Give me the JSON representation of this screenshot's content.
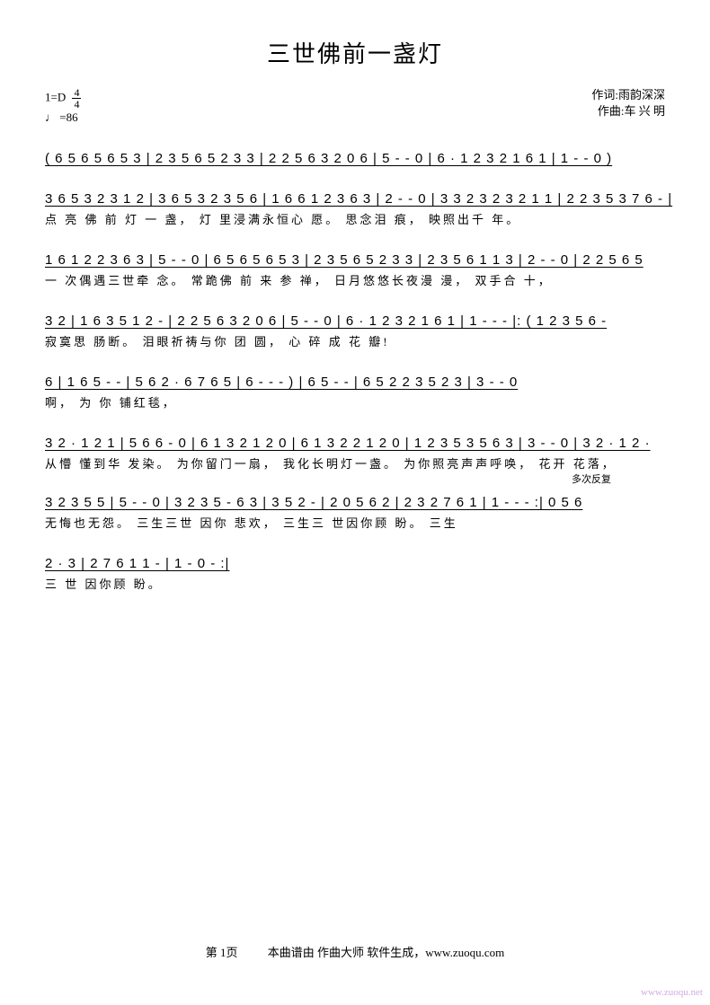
{
  "title": "三世佛前一盏灯",
  "key_sig": "1=D",
  "time_sig_top": "4",
  "time_sig_bot": "4",
  "tempo_mark": "♩ =86",
  "credits": {
    "lyricist_label": "作词:雨韵深深",
    "composer_label": "作曲:车 兴 明"
  },
  "intro_notation": "( 6 5 6 5 6 5 3 | 2 3 5 6 5 2 3 3 | 2 2 5 6 3 2 0 6 | 5  -  -  0 | 6 · 1 2 3 2 1 6 1 | 1  -  -  0  )",
  "lines": [
    {
      "notation": "3 6 5 3 2 3 1 2 | 3 6 5 3 2 3 5 6 | 1 6 6 1 2 3 6 3 | 2  -  -  0 | 3 3 2 3 2 3 2 1 1 | 2 2 3 5 3 7 6  - |",
      "lyrics": "点 亮 佛    前 灯 一   盏，    灯  里浸满永恒心  愿。            思念泪  痕，      映照出千    年。"
    },
    {
      "notation": "1 6 1 2 2 3 6 3 | 5  -  -  0 | 6 5 6 5 6 5 3 | 2 3 5 6 5 2 3 3 | 2 3 5 6 1 1 3 | 2  -  -  0 | 2 2 5 6 5",
      "lyrics": "一  次偶遇三世牵  念。             常跪佛      前 来  参  禅，    日月悠悠长夜漫  漫，            双手合  十，"
    },
    {
      "notation": "3 2 | 1 6 3 5 1 2  - | 2 2 5 6 3 2 0 6 | 5  -  -  0 | 6 · 1 2 3 2 1 6 1 | 1  -  -  - |: ( 1 2 3 5 6  -",
      "lyrics": "       寂寞思   肠断。    泪眼祈祷与你  团  圆，            心   碎 成  花      瓣!"
    },
    {
      "notation": "6 | 1 6 5  -  - | 5 6 2 · 6 7 6 5 | 6  -  -  - ) | 6  5  -  - | 6 5 2 2 3 5 2 3 | 3  -  -  0",
      "lyrics": "                                                                啊，              为  你    铺红毯，"
    },
    {
      "notation": "3 2 · 1 2 1 | 5 6 6  -  0 | 6 1 3 2 1 2 0 | 6 1 3 2 2 1 2 0 | 1 2 3 5 3 5 6 3 | 3  -  -  0 | 3 2 · 1 2 ·",
      "lyrics": "从懵  懂到华  发染。           为你留门一扇，   我化长明灯一盏。    为你照亮声声呼唤，               花开  花落，"
    },
    {
      "notation": "3 2 3 5 5 | 5  -  -  0 | 3 2 3 5  - 6 3 | 3 5 2  - | 2 0 5 6 2 | 2 3 2 7 6 1 | 1  -  -  - :| 0 5 6",
      "lyrics": "无悔也无怨。                  三生三世   因你    悲欢，     三生三    世因你顾   盼。                 三生",
      "anno": "多次反复"
    },
    {
      "notation": "2 · 3 | 2 7 6 1 1  - | 1  - 0  - :|",
      "lyrics": "三  世   因你顾   盼。"
    }
  ],
  "footer": {
    "page_label": "第 1页",
    "generator": "本曲谱由 作曲大师 软件生成，www.zuoqu.com"
  },
  "watermark": "www.zuoqu.net",
  "chart_data": {
    "type": "music_score",
    "notation_system": "jianpu",
    "key": "D",
    "time_signature": "4/4",
    "tempo_bpm": 86,
    "title": "三世佛前一盏灯",
    "lyricist": "雨韵深深",
    "composer": "车兴明"
  }
}
